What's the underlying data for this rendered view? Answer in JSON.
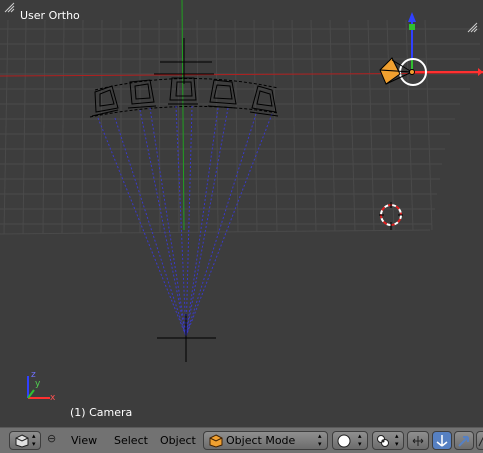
{
  "viewport": {
    "title": "User Ortho",
    "object_info": "(1) Camera",
    "axis_labels": {
      "x": "x",
      "y": "y",
      "z": "z"
    }
  },
  "header": {
    "menus": [
      "View",
      "Select",
      "Object"
    ],
    "mode_value": "Object Mode",
    "colors": {
      "header_bg": "#727272",
      "active_icon": "#5680c2",
      "axis_x": "#ff3030",
      "axis_y": "#30c030",
      "axis_z": "#3040ff",
      "camera_orange": "#f0a030",
      "dashed_blue": "#5050d0"
    },
    "icons": [
      "editor-type-cube-icon",
      "collapse-menu-icon",
      "object-mode-cube-icon",
      "viewport-shading-sphere-icon",
      "pivot-point-icon",
      "manipulator-icon",
      "translate-arrow-icon",
      "rotate-arrow-icon",
      "scale-icon"
    ]
  }
}
